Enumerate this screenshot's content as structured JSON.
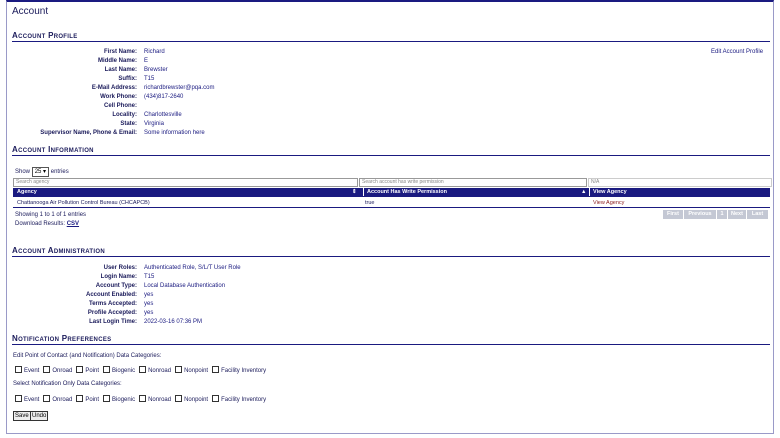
{
  "page": {
    "title": "Account"
  },
  "profile": {
    "heading": "Account Profile",
    "edit_link": "Edit Account Profile",
    "fields": [
      {
        "label": "First Name:",
        "value": "Richard"
      },
      {
        "label": "Middle Name:",
        "value": "E"
      },
      {
        "label": "Last Name:",
        "value": "Brewster"
      },
      {
        "label": "Suffix:",
        "value": "T15"
      },
      {
        "label": "E-Mail Address:",
        "value": "richardbrewster@pqa.com"
      },
      {
        "label": "Work Phone:",
        "value": "(434)817-2640"
      },
      {
        "label": "Cell Phone:",
        "value": ""
      },
      {
        "label": "Locality:",
        "value": "Charlottesville"
      },
      {
        "label": "State:",
        "value": "Virginia"
      },
      {
        "label": "Supervisor Name, Phone & Email:",
        "value": "Some information here"
      }
    ]
  },
  "info": {
    "heading": "Account Information",
    "show_label": "Show",
    "entries_value": "25",
    "entries_label": "entries",
    "search": {
      "agency_placeholder": "Search agency",
      "permission_placeholder": "Search account has write permission",
      "view_placeholder": "N/A"
    },
    "columns": [
      "Agency",
      "Account Has Write Permission",
      "View Agency"
    ],
    "rows": [
      {
        "agency": "Chattanooga Air Pollution Control Bureau (CHCAPCB)",
        "permission": "true",
        "view": "View Agency"
      }
    ],
    "showing": "Showing 1 to 1 of 1 entries",
    "download_label": "Download Results:",
    "csv_label": "CSV",
    "pager": [
      "First",
      "Previous",
      "1",
      "Next",
      "Last"
    ]
  },
  "admin": {
    "heading": "Account Administration",
    "fields": [
      {
        "label": "User Roles:",
        "value": "Authenticated Role, S/L/T User Role"
      },
      {
        "label": "Login Name:",
        "value": "T15"
      },
      {
        "label": "Account Type:",
        "value": "Local Database Authentication"
      },
      {
        "label": "Account Enabled:",
        "value": "yes"
      },
      {
        "label": "Terms Accepted:",
        "value": "yes"
      },
      {
        "label": "Profile Accepted:",
        "value": "yes"
      },
      {
        "label": "Last Login Time:",
        "value": "2022-03-16 07:36 PM"
      }
    ]
  },
  "notifications": {
    "heading": "Notification Preferences",
    "poc_label": "Edit Point of Contact (and Notification) Data Categories:",
    "only_label": "Select Notification Only Data Categories:",
    "categories": [
      "Event",
      "Onroad",
      "Point",
      "Biogenic",
      "Nonroad",
      "Nonpoint",
      "Facility Inventory"
    ],
    "save_label": "Save",
    "undo_label": "Undo"
  }
}
